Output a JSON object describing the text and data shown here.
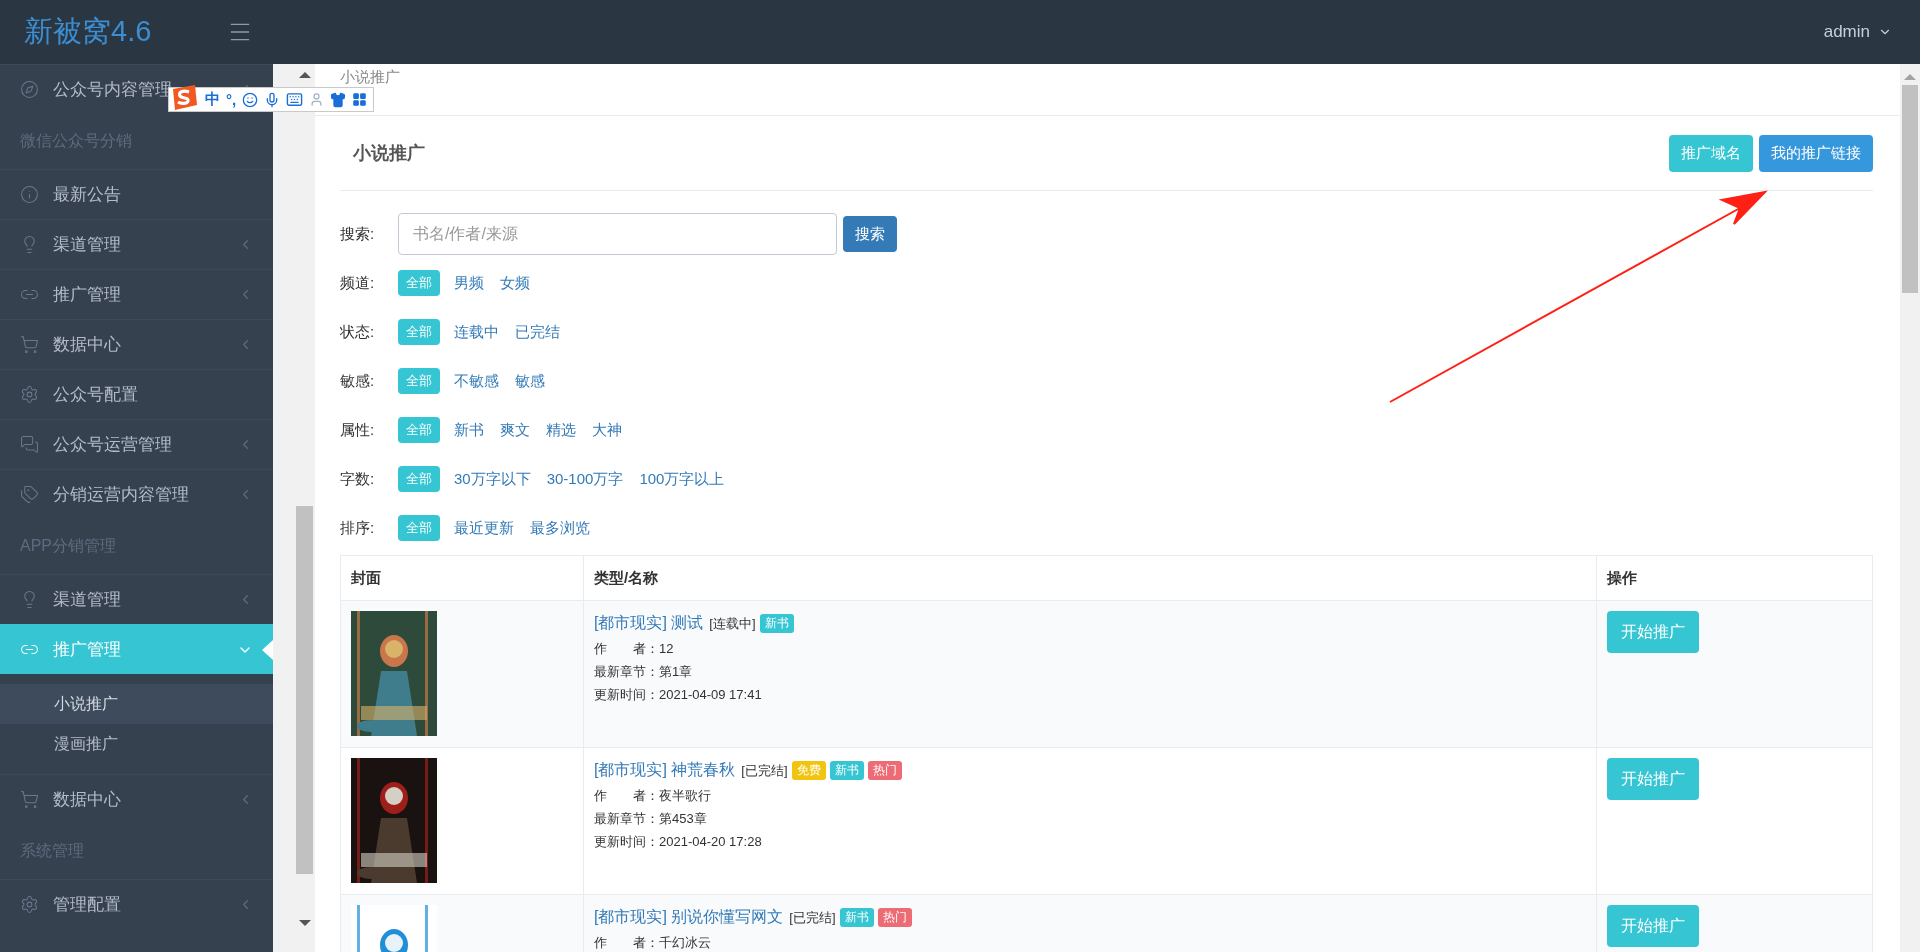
{
  "topbar": {
    "logo": "新被窝4.6",
    "user": "admin"
  },
  "ime_toolbar": {
    "mode": "中",
    "punctuation": "°,"
  },
  "sidebar": {
    "items": [
      {
        "kind": "item",
        "label": "公众号内容管理",
        "expanded": false,
        "selected": false
      },
      {
        "kind": "header",
        "label": "微信公众号分销"
      },
      {
        "kind": "item",
        "label": "最新公告",
        "selected": false
      },
      {
        "kind": "item",
        "label": "渠道管理",
        "expanded": false,
        "selected": false
      },
      {
        "kind": "item",
        "label": "推广管理",
        "expanded": false,
        "selected": false
      },
      {
        "kind": "item",
        "label": "数据中心",
        "expanded": false,
        "selected": false
      },
      {
        "kind": "item",
        "label": "公众号配置",
        "selected": false
      },
      {
        "kind": "item",
        "label": "公众号运营管理",
        "expanded": false,
        "selected": false
      },
      {
        "kind": "item",
        "label": "分销运营内容管理",
        "expanded": false,
        "selected": false
      },
      {
        "kind": "header",
        "label": "APP分销管理"
      },
      {
        "kind": "item",
        "label": "渠道管理",
        "expanded": false,
        "selected": false
      },
      {
        "kind": "item",
        "label": "推广管理",
        "expanded": true,
        "selected": true,
        "children": [
          {
            "label": "小说推广",
            "selected": true
          },
          {
            "label": "漫画推广",
            "selected": false
          }
        ]
      },
      {
        "kind": "item",
        "label": "数据中心",
        "expanded": false,
        "selected": false
      },
      {
        "kind": "header",
        "label": "系统管理"
      },
      {
        "kind": "item",
        "label": "管理配置",
        "expanded": false,
        "selected": false
      }
    ]
  },
  "breadcrumb": "小说推广",
  "panel": {
    "title": "小说推广",
    "buttons": [
      {
        "label": "推广域名",
        "kind": "info"
      },
      {
        "label": "我的推广链接",
        "kind": "primary"
      }
    ]
  },
  "search": {
    "label": "搜索:",
    "placeholder": "书名/作者/来源",
    "button": "搜索"
  },
  "filters": [
    {
      "label": "频道:",
      "options": [
        {
          "label": "全部",
          "selected": true
        },
        {
          "label": "男频",
          "selected": false
        },
        {
          "label": "女频",
          "selected": false
        }
      ]
    },
    {
      "label": "状态:",
      "options": [
        {
          "label": "全部",
          "selected": true
        },
        {
          "label": "连载中",
          "selected": false
        },
        {
          "label": "已完结",
          "selected": false
        }
      ]
    },
    {
      "label": "敏感:",
      "options": [
        {
          "label": "全部",
          "selected": true
        },
        {
          "label": "不敏感",
          "selected": false
        },
        {
          "label": "敏感",
          "selected": false
        }
      ]
    },
    {
      "label": "属性:",
      "options": [
        {
          "label": "全部",
          "selected": true
        },
        {
          "label": "新书",
          "selected": false
        },
        {
          "label": "爽文",
          "selected": false
        },
        {
          "label": "精选",
          "selected": false
        },
        {
          "label": "大神",
          "selected": false
        }
      ]
    },
    {
      "label": "字数:",
      "options": [
        {
          "label": "全部",
          "selected": true
        },
        {
          "label": "30万字以下",
          "selected": false
        },
        {
          "label": "30-100万字",
          "selected": false
        },
        {
          "label": "100万字以上",
          "selected": false
        }
      ]
    },
    {
      "label": "排序:",
      "options": [
        {
          "label": "全部",
          "selected": true
        },
        {
          "label": "最近更新",
          "selected": false
        },
        {
          "label": "最多浏览",
          "selected": false
        }
      ]
    }
  ],
  "table": {
    "columns": [
      "封面",
      "类型/名称",
      "操作"
    ],
    "rows": [
      {
        "cover": {
          "kind": "picture"
        },
        "title": "[都市现实] 测试",
        "status": "[连载中]",
        "tags": [
          {
            "label": "新书",
            "color": "#36c6d3"
          }
        ],
        "lines": [
          "作　　者：12",
          "最新章节：第1章",
          "更新时间：2021-04-09 17:41"
        ],
        "action": "开始推广"
      },
      {
        "cover": {
          "kind": "picture"
        },
        "title": "[都市现实] 神荒春秋",
        "status": "[已完结]",
        "tags": [
          {
            "label": "免费",
            "color": "#f1c40f"
          },
          {
            "label": "新书",
            "color": "#36c6d3"
          },
          {
            "label": "热门",
            "color": "#ed6b75"
          }
        ],
        "lines": [
          "作　　者：夜半歌行",
          "最新章节：第453章",
          "更新时间：2021-04-20 17:28"
        ],
        "action": "开始推广"
      },
      {
        "cover": {
          "kind": "picture"
        },
        "title": "[都市现实] 别说你懂写网文",
        "status": "[已完结]",
        "tags": [
          {
            "label": "新书",
            "color": "#36c6d3"
          },
          {
            "label": "热门",
            "color": "#ed6b75"
          }
        ],
        "lines": [
          "作　　者：千幻冰云"
        ],
        "action": "开始推广"
      }
    ]
  }
}
